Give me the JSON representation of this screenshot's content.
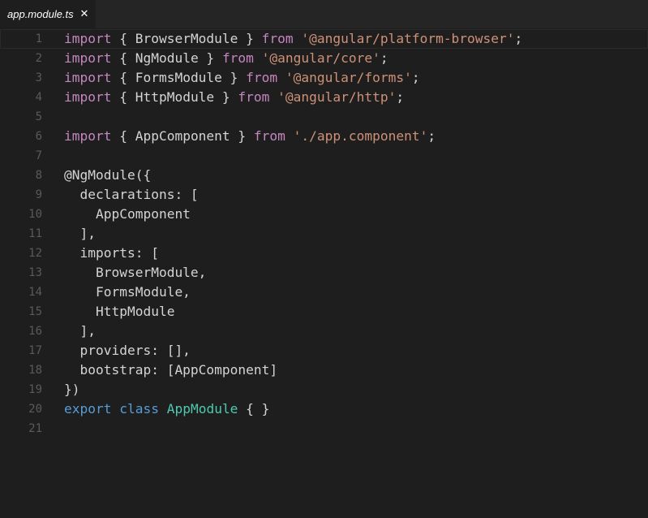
{
  "tab": {
    "label": "app.module.ts",
    "close_glyph": "✕"
  },
  "colors": {
    "background": "#1e1e1e",
    "keyword": "#c586c0",
    "declaration_keyword": "#569cd6",
    "string": "#ce9178",
    "class_name": "#4ec9b0",
    "text": "#d4d4d4",
    "line_number": "#5a5a5a"
  },
  "lines": [
    {
      "n": "1",
      "tokens": [
        [
          "kw",
          "import"
        ],
        [
          "p",
          " { BrowserModule } "
        ],
        [
          "kw",
          "from"
        ],
        [
          "p",
          " "
        ],
        [
          "str",
          "'@angular/platform-browser'"
        ],
        [
          "p",
          ";"
        ]
      ]
    },
    {
      "n": "2",
      "tokens": [
        [
          "kw",
          "import"
        ],
        [
          "p",
          " { NgModule } "
        ],
        [
          "kw",
          "from"
        ],
        [
          "p",
          " "
        ],
        [
          "str",
          "'@angular/core'"
        ],
        [
          "p",
          ";"
        ]
      ]
    },
    {
      "n": "3",
      "tokens": [
        [
          "kw",
          "import"
        ],
        [
          "p",
          " { FormsModule } "
        ],
        [
          "kw",
          "from"
        ],
        [
          "p",
          " "
        ],
        [
          "str",
          "'@angular/forms'"
        ],
        [
          "p",
          ";"
        ]
      ]
    },
    {
      "n": "4",
      "tokens": [
        [
          "kw",
          "import"
        ],
        [
          "p",
          " { HttpModule } "
        ],
        [
          "kw",
          "from"
        ],
        [
          "p",
          " "
        ],
        [
          "str",
          "'@angular/http'"
        ],
        [
          "p",
          ";"
        ]
      ]
    },
    {
      "n": "5",
      "tokens": []
    },
    {
      "n": "6",
      "tokens": [
        [
          "kw",
          "import"
        ],
        [
          "p",
          " { AppComponent } "
        ],
        [
          "kw",
          "from"
        ],
        [
          "p",
          " "
        ],
        [
          "str",
          "'./app.component'"
        ],
        [
          "p",
          ";"
        ]
      ]
    },
    {
      "n": "7",
      "tokens": []
    },
    {
      "n": "8",
      "tokens": [
        [
          "p",
          "@NgModule({"
        ]
      ]
    },
    {
      "n": "9",
      "tokens": [
        [
          "p",
          "  declarations: ["
        ]
      ]
    },
    {
      "n": "10",
      "tokens": [
        [
          "p",
          "    AppComponent"
        ]
      ]
    },
    {
      "n": "11",
      "tokens": [
        [
          "p",
          "  ],"
        ]
      ]
    },
    {
      "n": "12",
      "tokens": [
        [
          "p",
          "  imports: ["
        ]
      ]
    },
    {
      "n": "13",
      "tokens": [
        [
          "p",
          "    BrowserModule,"
        ]
      ]
    },
    {
      "n": "14",
      "tokens": [
        [
          "p",
          "    FormsModule,"
        ]
      ]
    },
    {
      "n": "15",
      "tokens": [
        [
          "p",
          "    HttpModule"
        ]
      ]
    },
    {
      "n": "16",
      "tokens": [
        [
          "p",
          "  ],"
        ]
      ]
    },
    {
      "n": "17",
      "tokens": [
        [
          "p",
          "  providers: [],"
        ]
      ]
    },
    {
      "n": "18",
      "tokens": [
        [
          "p",
          "  bootstrap: [AppComponent]"
        ]
      ]
    },
    {
      "n": "19",
      "tokens": [
        [
          "p",
          "})"
        ]
      ]
    },
    {
      "n": "20",
      "tokens": [
        [
          "kw2",
          "export"
        ],
        [
          "p",
          " "
        ],
        [
          "kw2",
          "class"
        ],
        [
          "p",
          " "
        ],
        [
          "cls",
          "AppModule"
        ],
        [
          "p",
          " { }"
        ]
      ]
    },
    {
      "n": "21",
      "tokens": []
    }
  ]
}
